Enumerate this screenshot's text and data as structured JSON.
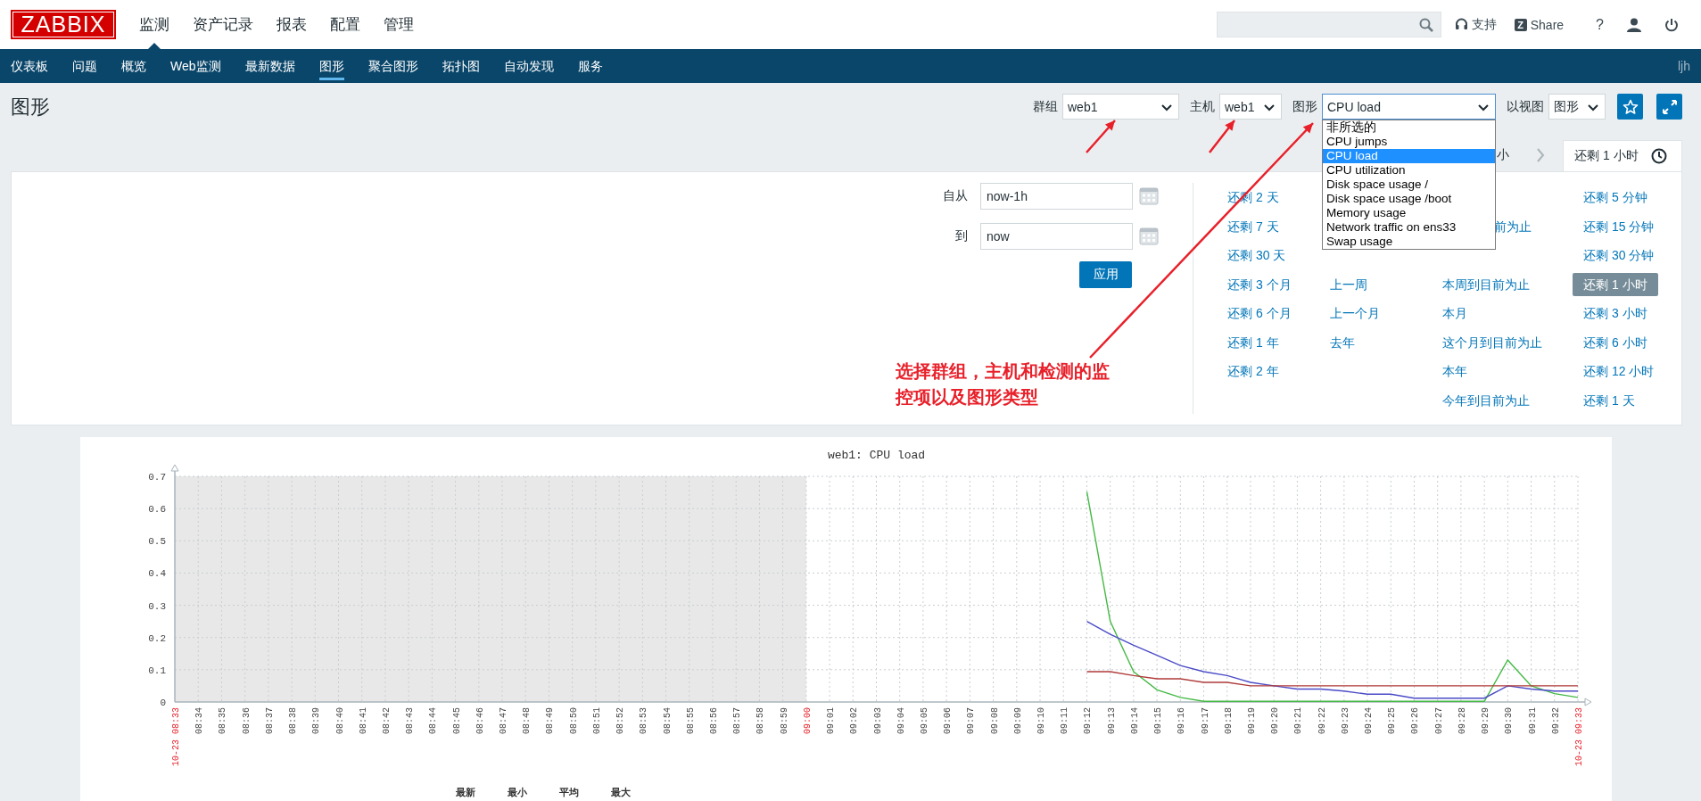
{
  "header": {
    "logo": "ZABBIX",
    "menu": [
      {
        "label": "监测",
        "selected": true
      },
      {
        "label": "资产记录",
        "selected": false
      },
      {
        "label": "报表",
        "selected": false
      },
      {
        "label": "配置",
        "selected": false
      },
      {
        "label": "管理",
        "selected": false
      }
    ],
    "tools": [
      {
        "kind": "support",
        "label": "支持"
      },
      {
        "kind": "share",
        "icon": "Z",
        "label": "Share"
      },
      {
        "kind": "help",
        "label": "?"
      },
      {
        "kind": "profile"
      },
      {
        "kind": "logout"
      }
    ]
  },
  "subnav": {
    "items": [
      {
        "label": "仪表板",
        "selected": false
      },
      {
        "label": "问题",
        "selected": false
      },
      {
        "label": "概览",
        "selected": false
      },
      {
        "label": "Web监测",
        "selected": false
      },
      {
        "label": "最新数据",
        "selected": false
      },
      {
        "label": "图形",
        "selected": true
      },
      {
        "label": "聚合图形",
        "selected": false
      },
      {
        "label": "拓扑图",
        "selected": false
      },
      {
        "label": "自动发现",
        "selected": false
      },
      {
        "label": "服务",
        "selected": false
      }
    ],
    "user": "ljh"
  },
  "page_title": "图形",
  "filters": [
    {
      "label": "群组",
      "value": "web1",
      "expanded": false
    },
    {
      "label": "主机",
      "value": "web1",
      "expanded": false
    },
    {
      "label": "图形",
      "value": "CPU load",
      "expanded": true,
      "options": [
        {
          "label": "非所选的",
          "selected": false
        },
        {
          "label": "CPU jumps",
          "selected": false
        },
        {
          "label": "CPU load",
          "selected": true
        },
        {
          "label": "CPU utilization",
          "selected": false
        },
        {
          "label": "Disk space usage /",
          "selected": false
        },
        {
          "label": "Disk space usage /boot",
          "selected": false
        },
        {
          "label": "Memory usage",
          "selected": false
        },
        {
          "label": "Network traffic on ens33",
          "selected": false
        },
        {
          "label": "Swap usage",
          "selected": false
        }
      ]
    },
    {
      "label": "以视图",
      "value": "图形",
      "expanded": false
    }
  ],
  "time_tabs": {
    "cut_label": "小",
    "active_tab": "还剩 1 小时"
  },
  "time_filter": {
    "from_label": "自从",
    "from": "now-1h",
    "to_label": "到",
    "to": "now",
    "apply": "应用"
  },
  "quick_ranges": [
    [
      {
        "label": "还剩 2 天",
        "selected": false
      },
      {
        "label": "还剩 7 天",
        "selected": false
      },
      {
        "label": "还剩 30 天",
        "selected": false
      },
      {
        "label": "还剩 3 个月",
        "selected": false
      },
      {
        "label": "还剩 6 个月",
        "selected": false
      },
      {
        "label": "还剩 1 年",
        "selected": false
      },
      {
        "label": "还剩 2 年",
        "selected": false
      }
    ],
    [
      {
        "kind": "covered"
      },
      {
        "kind": "covered"
      },
      {
        "kind": "covered"
      },
      {
        "label": "上一周",
        "selected": false
      },
      {
        "label": "上一个月",
        "selected": false
      },
      {
        "label": "去年",
        "selected": false
      }
    ],
    [
      {
        "kind": "covered"
      },
      {
        "label": "前为止",
        "selected": false,
        "kind": "cut"
      },
      {
        "kind": "covered"
      },
      {
        "label": "本周到目前为止",
        "selected": false
      },
      {
        "label": "本月",
        "selected": false
      },
      {
        "label": "这个月到目前为止",
        "selected": false
      },
      {
        "label": "本年",
        "selected": false
      },
      {
        "label": "今年到目前为止",
        "selected": false
      }
    ],
    [
      {
        "label": "还剩 5 分钟",
        "selected": false
      },
      {
        "label": "还剩 15 分钟",
        "selected": false
      },
      {
        "label": "还剩 30 分钟",
        "selected": false
      },
      {
        "label": "还剩 1 小时",
        "selected": true
      },
      {
        "label": "还剩 3 小时",
        "selected": false
      },
      {
        "label": "还剩 6 小时",
        "selected": false
      },
      {
        "label": "还剩 12 小时",
        "selected": false
      },
      {
        "label": "还剩 1 天",
        "selected": false
      }
    ]
  ],
  "annotation": "选择群组，主机和检测的监控项以及图形类型",
  "graph": {
    "chart_data": {
      "type": "line",
      "title": "web1: CPU load",
      "x": [
        "10-23 08:33",
        "08:34",
        "08:35",
        "08:36",
        "08:37",
        "08:38",
        "08:39",
        "08:40",
        "08:41",
        "08:42",
        "08:43",
        "08:44",
        "08:45",
        "08:46",
        "08:47",
        "08:48",
        "08:49",
        "08:50",
        "08:51",
        "08:52",
        "08:53",
        "08:54",
        "08:55",
        "08:56",
        "08:57",
        "08:58",
        "08:59",
        "09:00",
        "09:01",
        "09:02",
        "09:03",
        "09:04",
        "09:05",
        "09:06",
        "09:07",
        "09:08",
        "09:09",
        "09:10",
        "09:11",
        "09:12",
        "09:13",
        "09:14",
        "09:15",
        "09:16",
        "09:17",
        "09:18",
        "09:19",
        "09:20",
        "09:21",
        "09:22",
        "09:23",
        "09:24",
        "09:25",
        "09:26",
        "09:27",
        "09:28",
        "09:29",
        "09:30",
        "09:31",
        "09:32",
        "10-23 09:33"
      ],
      "series": [
        {
          "color": "#44b944",
          "values": [
            null,
            null,
            null,
            null,
            null,
            null,
            null,
            null,
            null,
            null,
            null,
            null,
            null,
            null,
            null,
            null,
            null,
            null,
            null,
            null,
            null,
            null,
            null,
            null,
            null,
            null,
            null,
            null,
            null,
            null,
            null,
            null,
            null,
            null,
            null,
            null,
            null,
            null,
            null,
            0.652,
            0.25,
            0.094,
            0.038,
            0.014,
            0.002,
            0.002,
            0.002,
            0.002,
            0.002,
            0.002,
            0.002,
            0.002,
            0.002,
            0.002,
            0.002,
            0.002,
            0.002,
            0.13,
            0.05,
            0.026,
            0.014
          ]
        },
        {
          "color": "#4b4bc8",
          "values": [
            null,
            null,
            null,
            null,
            null,
            null,
            null,
            null,
            null,
            null,
            null,
            null,
            null,
            null,
            null,
            null,
            null,
            null,
            null,
            null,
            null,
            null,
            null,
            null,
            null,
            null,
            null,
            null,
            null,
            null,
            null,
            null,
            null,
            null,
            null,
            null,
            null,
            null,
            null,
            0.25,
            0.21,
            0.176,
            0.145,
            0.113,
            0.094,
            0.082,
            0.061,
            0.05,
            0.04,
            0.04,
            0.034,
            0.024,
            0.024,
            0.012,
            0.012,
            0.012,
            0.012,
            0.05,
            0.04,
            0.034,
            0.034
          ]
        },
        {
          "color": "#b03a3a",
          "values": [
            null,
            null,
            null,
            null,
            null,
            null,
            null,
            null,
            null,
            null,
            null,
            null,
            null,
            null,
            null,
            null,
            null,
            null,
            null,
            null,
            null,
            null,
            null,
            null,
            null,
            null,
            null,
            null,
            null,
            null,
            null,
            null,
            null,
            null,
            null,
            null,
            null,
            null,
            null,
            0.094,
            0.094,
            0.082,
            0.072,
            0.072,
            0.061,
            0.061,
            0.05,
            0.05,
            0.05,
            0.05,
            0.05,
            0.05,
            0.05,
            0.05,
            0.05,
            0.05,
            0.05,
            0.05,
            0.05,
            0.05,
            0.05
          ]
        }
      ],
      "ylim": [
        0,
        0.7
      ],
      "yticks": [
        0,
        0.1,
        0.2,
        0.3,
        0.4,
        0.5,
        0.6,
        0.7
      ],
      "grid": true,
      "annotations": [
        {
          "x": "10-23 08:33"
        },
        {
          "x": "09:00"
        },
        {
          "x": "10-23 09:33"
        }
      ]
    },
    "legend_headers": [
      "最新",
      "最小",
      "平均",
      "最大"
    ]
  }
}
